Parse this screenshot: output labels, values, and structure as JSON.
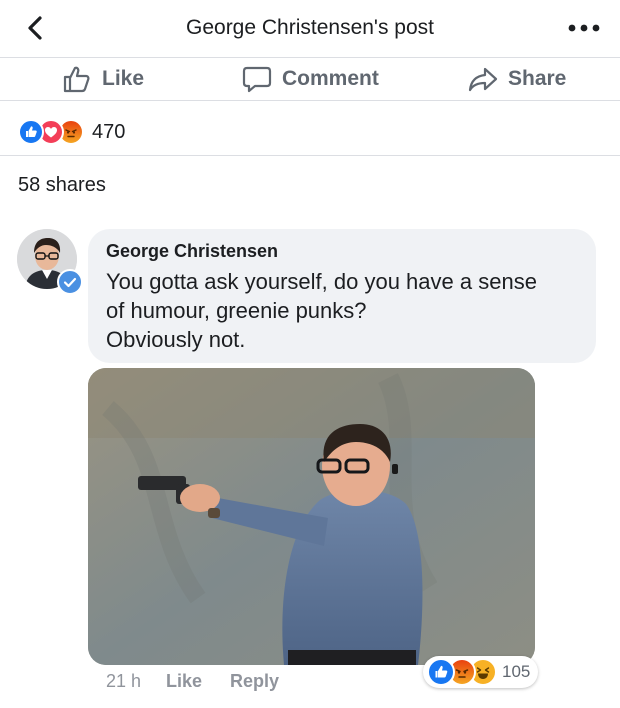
{
  "header": {
    "title": "George Christensen's post"
  },
  "actions": {
    "like": "Like",
    "comment": "Comment",
    "share": "Share"
  },
  "post_stats": {
    "reaction_count": "470",
    "shares": "58 shares"
  },
  "comment": {
    "author": "George Christensen",
    "text": "You gotta ask yourself, do you have a sense\nof humour, greenie punks?\nObviously not.",
    "time": "21 h",
    "like_label": "Like",
    "reply_label": "Reply",
    "reaction_count": "105"
  },
  "icons": {
    "back": "chevron-left-icon",
    "more": "more-dots-icon",
    "like": "thumbs-up-icon",
    "comment": "speech-bubble-icon",
    "share": "share-arrow-icon",
    "verified": "verified-check-icon"
  },
  "colors": {
    "like": "#1877f2",
    "love": "#f33e58",
    "angry": "#e9710f",
    "haha": "#f7b125",
    "muted": "#606770",
    "bubble": "#f0f2f5"
  }
}
